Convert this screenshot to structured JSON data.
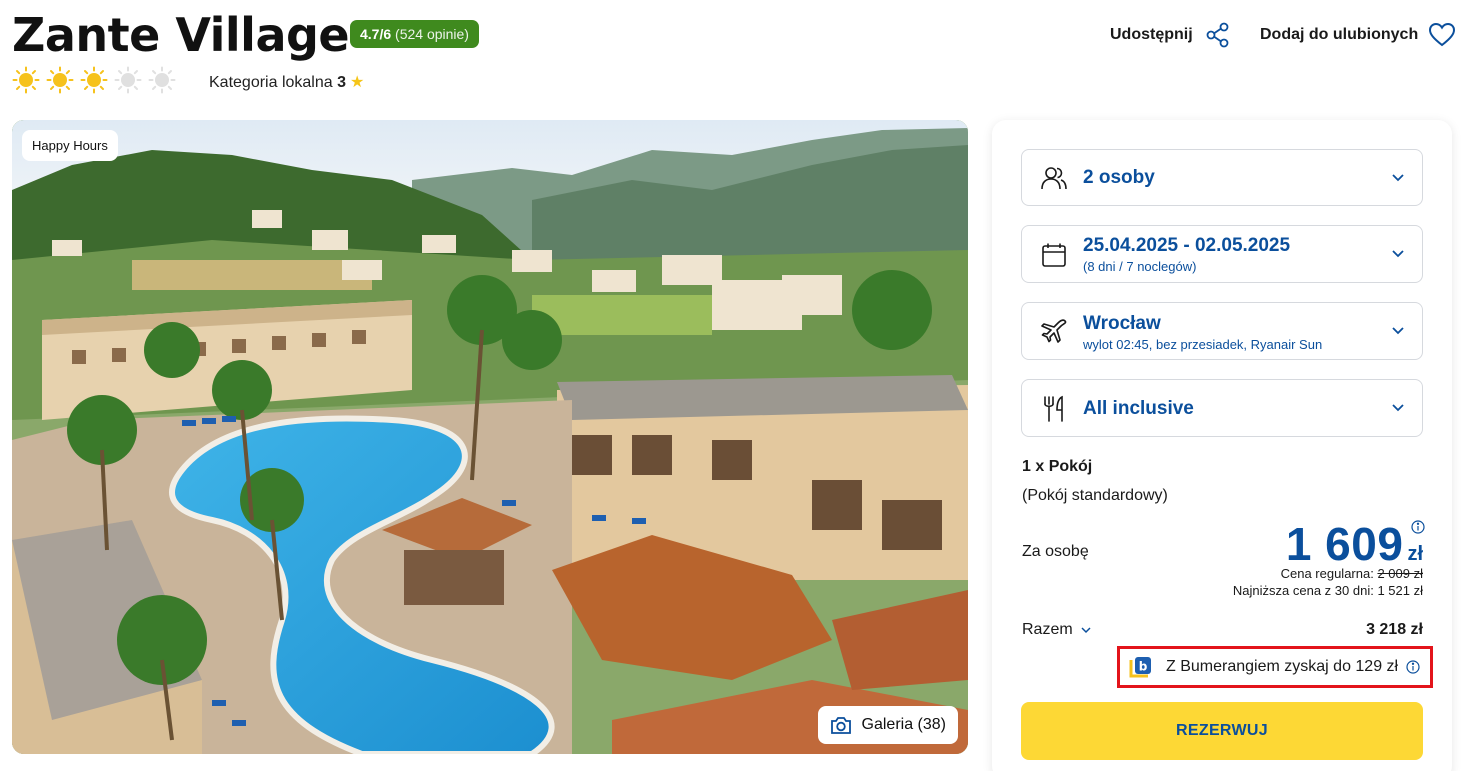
{
  "header": {
    "title": "Zante Village",
    "rating_score": "4.7/6",
    "rating_count": "(524 opinie)",
    "sun_rating": 3,
    "sun_max": 5,
    "local_category_label": "Kategoria lokalna",
    "local_category_value": "3",
    "share_label": "Udostępnij",
    "favorite_label": "Dodaj do ulubionych"
  },
  "photo": {
    "badge": "Happy Hours",
    "gallery_label": "Galeria (38)"
  },
  "booking": {
    "people": "2 osoby",
    "dates": "25.04.2025 - 02.05.2025",
    "dates_sub": "(8 dni / 7 noclegów)",
    "departure_city": "Wrocław",
    "departure_sub": "wylot 02:45, bez przesiadek, Ryanair Sun",
    "board": "All inclusive",
    "room_title": "1 x Pokój",
    "room_type": "(Pokój standardowy)",
    "per_person_label": "Za osobę",
    "price": "1 609",
    "currency": "zł",
    "regular_label": "Cena regularna:",
    "regular_price": "2 009 zł",
    "lowest_label": "Najniższa cena z 30 dni:",
    "lowest_price": "1 521 zł",
    "total_label": "Razem",
    "total_value": "3 218 zł",
    "boomerang_text": "Z Bumerangiem zyskaj do 129 zł",
    "reserve_label": "REZERWUJ"
  },
  "colors": {
    "brand_blue": "#0b4f9c",
    "rating_green": "#3f8a1e",
    "reserve_yellow": "#fdd835",
    "sun_gold": "#f6c21c",
    "highlight_red": "#e3141b"
  }
}
